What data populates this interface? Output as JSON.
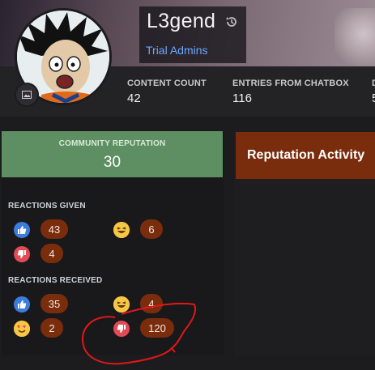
{
  "profile": {
    "name": "L3gend",
    "group": "Trial Admins"
  },
  "stats": [
    {
      "label": "CONTENT COUNT",
      "value": "42"
    },
    {
      "label": "ENTRIES FROM CHATBOX",
      "value": "116"
    },
    {
      "label": "D",
      "value": "5"
    }
  ],
  "reputation": {
    "label": "COMMUNITY REPUTATION",
    "value": "30"
  },
  "reactions_given": {
    "title": "REACTIONS GIVEN",
    "items": [
      {
        "icon": "like-icon",
        "count": "43"
      },
      {
        "icon": "haha-icon",
        "count": "6"
      },
      {
        "icon": "dislike-icon",
        "count": "4"
      }
    ]
  },
  "reactions_received": {
    "title": "REACTIONS RECEIVED",
    "items": [
      {
        "icon": "like-icon",
        "count": "35"
      },
      {
        "icon": "haha-icon",
        "count": "4"
      },
      {
        "icon": "love-icon",
        "count": "2"
      },
      {
        "icon": "dislike-icon",
        "count": "120"
      }
    ]
  },
  "activity": {
    "title": "Reputation Activity"
  },
  "colors": {
    "accent": "#7a2d0d",
    "reputation_bg": "#5d8f62",
    "group_link": "#6aa9ff",
    "scribble": "#e01818"
  }
}
